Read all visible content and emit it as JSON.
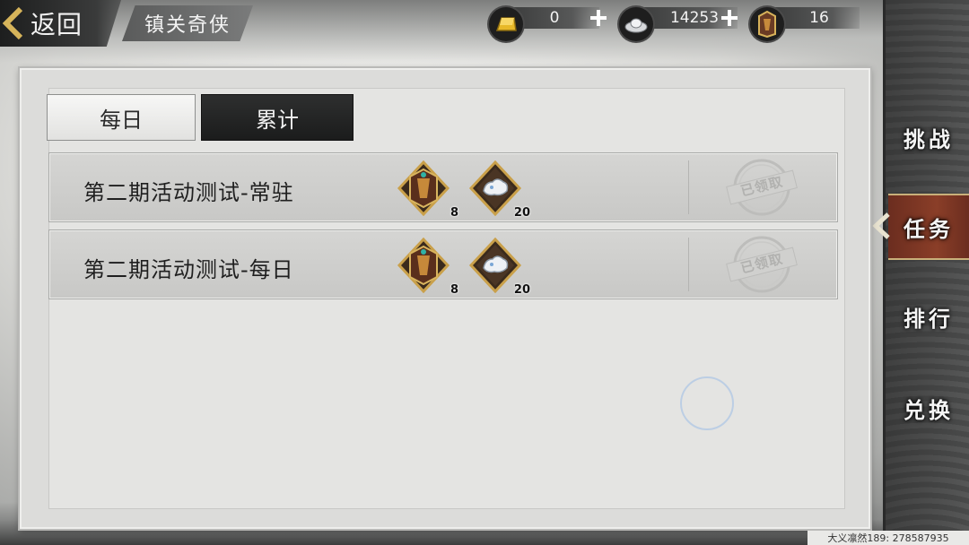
{
  "header": {
    "back_label": "返回",
    "title": "镇关奇侠"
  },
  "currencies": [
    {
      "icon": "gold-bar-icon",
      "value": "0"
    },
    {
      "icon": "silver-ingot-icon",
      "value": "14253"
    },
    {
      "icon": "token-icon",
      "value": "16"
    }
  ],
  "tabs": [
    {
      "label": "每日",
      "active": false
    },
    {
      "label": "累计",
      "active": true
    }
  ],
  "tasks": [
    {
      "name": "第二期活动测试-常驻",
      "rewards": [
        {
          "icon": "token-icon",
          "count": "8"
        },
        {
          "icon": "silver-ore-icon",
          "count": "20"
        }
      ],
      "status": "已领取"
    },
    {
      "name": "第二期活动测试-每日",
      "rewards": [
        {
          "icon": "token-icon",
          "count": "8"
        },
        {
          "icon": "silver-ore-icon",
          "count": "20"
        }
      ],
      "status": "已领取"
    }
  ],
  "sidenav": {
    "items": [
      {
        "label": "挑战",
        "active": false
      },
      {
        "label": "任务",
        "active": true
      },
      {
        "label": "排行",
        "active": false
      },
      {
        "label": "兑换",
        "active": false
      }
    ]
  },
  "watermark": "大义凛然189: 278587935",
  "colors": {
    "active_nav": "#8a3e28",
    "active_tab": "#1b1c1c",
    "gold_frame": "#c9a04a"
  }
}
